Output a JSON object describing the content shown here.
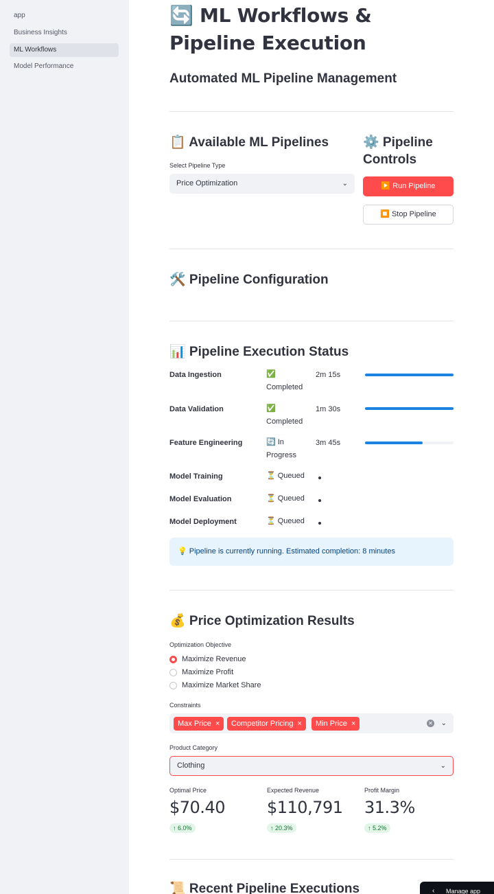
{
  "sidebar": {
    "items": [
      {
        "label": "app"
      },
      {
        "label": "Business Insights"
      },
      {
        "label": "ML Workflows"
      },
      {
        "label": "Model Performance"
      }
    ]
  },
  "header": {
    "title": "🔄 ML Workflows & Pipeline Execution",
    "subtitle": "Automated ML Pipeline Management"
  },
  "pipelines": {
    "heading": "📋 Available ML Pipelines",
    "select_label": "Select Pipeline Type",
    "selected": "Price Optimization"
  },
  "controls": {
    "heading": "⚙️ Pipeline Controls",
    "run_label": "▶️ Run Pipeline",
    "stop_label": "⏹️ Stop Pipeline"
  },
  "configuration": {
    "heading": "🛠️ Pipeline Configuration"
  },
  "status": {
    "heading": "📊 Pipeline Execution Status",
    "stages": [
      {
        "name": "Data Ingestion",
        "status": "✅ Completed",
        "time": "2m 15s",
        "progress": 1.0
      },
      {
        "name": "Data Validation",
        "status": "✅ Completed",
        "time": "1m 30s",
        "progress": 1.0
      },
      {
        "name": "Feature Engineering",
        "status": "🔄 In Progress",
        "time": "3m 45s",
        "progress": 0.65
      },
      {
        "name": "Model Training",
        "status": "⏳ Queued",
        "time": "",
        "progress": 0
      },
      {
        "name": "Model Evaluation",
        "status": "⏳ Queued",
        "time": "",
        "progress": 0
      },
      {
        "name": "Model Deployment",
        "status": "⏳ Queued",
        "time": "",
        "progress": 0
      }
    ],
    "info": "💡 Pipeline is currently running. Estimated completion: 8 minutes"
  },
  "results": {
    "heading": "💰 Price Optimization Results",
    "objective_label": "Optimization Objective",
    "objectives": [
      {
        "label": "Maximize Revenue",
        "selected": true
      },
      {
        "label": "Maximize Profit",
        "selected": false
      },
      {
        "label": "Maximize Market Share",
        "selected": false
      }
    ],
    "constraints_label": "Constraints",
    "constraints": [
      "Max Price",
      "Competitor Pricing",
      "Min Price"
    ],
    "category_label": "Product Category",
    "category": "Clothing",
    "metrics": [
      {
        "label": "Optimal Price",
        "value": "$70.40",
        "delta": "6.0%"
      },
      {
        "label": "Expected Revenue",
        "value": "$110,791",
        "delta": "20.3%"
      },
      {
        "label": "Profit Margin",
        "value": "31.3%",
        "delta": "5.2%"
      }
    ]
  },
  "recent": {
    "heading": "📜 Recent Pipeline Executions"
  },
  "manage_app": {
    "label": "Manage app"
  },
  "colors": {
    "primary": "#ff4b4b",
    "progress": "#1c83e1",
    "info_bg": "#e8f4fd",
    "sidebar_bg": "#f0f2f6"
  }
}
